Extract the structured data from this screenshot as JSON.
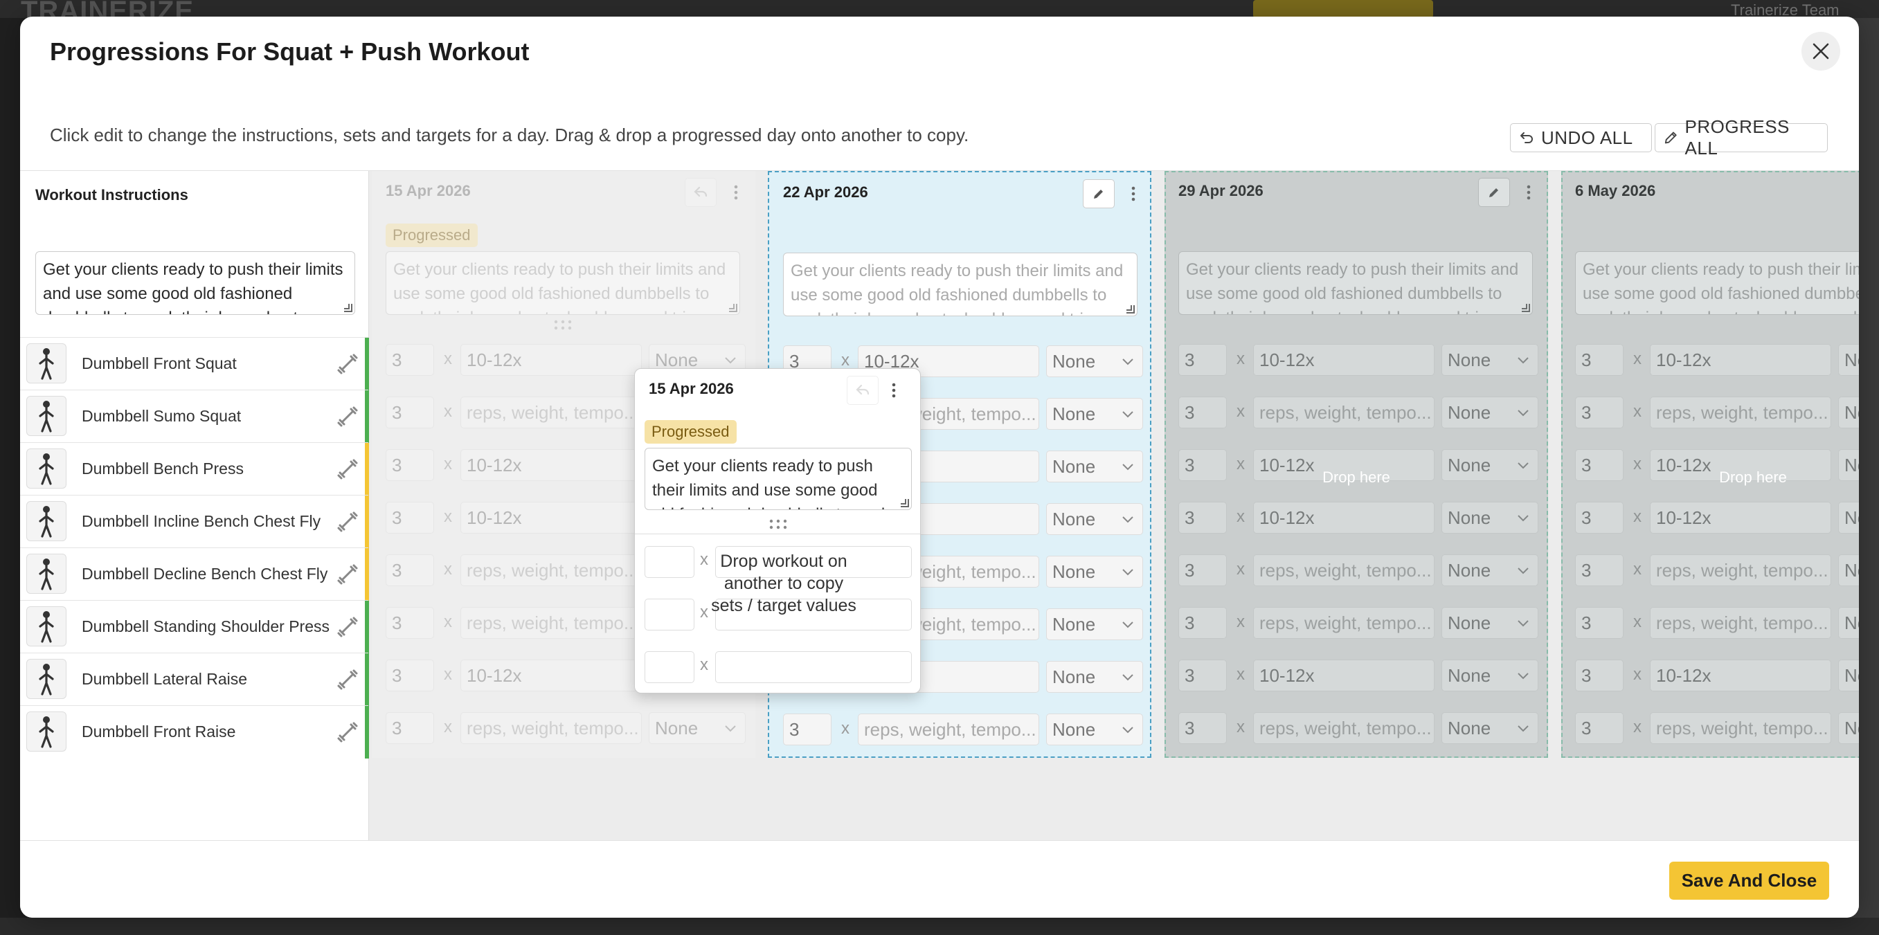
{
  "modal": {
    "title": "Progressions For Squat + Push Workout",
    "hint": "Click edit to change the instructions, sets and targets for a day. Drag & drop a progressed day onto another to copy.",
    "undo_all": "UNDO ALL",
    "progress_all": "PROGRESS ALL",
    "save_close": "Save And Close"
  },
  "left": {
    "label": "Workout Instructions",
    "instructions": "Get your clients ready to push their limits and use some good old fashioned dumbbells to work their legs, chest, shoulders, and triceps.",
    "exercises": [
      {
        "name": "Dumbbell Front Squat",
        "bar": "#4caf50"
      },
      {
        "name": "Dumbbell Sumo Squat",
        "bar": "#4caf50"
      },
      {
        "name": "Dumbbell Bench Press",
        "bar": "#f4c534"
      },
      {
        "name": "Dumbbell Incline Bench Chest Fly",
        "bar": "#f4c534"
      },
      {
        "name": "Dumbbell Decline Bench Chest Fly",
        "bar": "#f4c534"
      },
      {
        "name": "Dumbbell Standing Shoulder Press",
        "bar": "#4caf50"
      },
      {
        "name": "Dumbbell Lateral Raise",
        "bar": "#4caf50"
      },
      {
        "name": "Dumbbell Front Raise",
        "bar": "#4caf50"
      }
    ]
  },
  "columns": [
    {
      "date": "15 Apr 2026",
      "badge": "Progressed",
      "instructions": "Get your clients ready to push their limits and use some good old fashioned dumbbells to work their legs, chest, shoulders, and triceps."
    },
    {
      "date": "22 Apr 2026",
      "instructions": "Get your clients ready to push their limits and use some good old fashioned dumbbells to work their legs, chest, shoulders, and triceps."
    },
    {
      "date": "29 Apr 2026",
      "instructions": "Get your clients ready to push their limits and use some good old fashioned dumbbells to work their legs, chest, shoulders, and triceps.",
      "drop_label": "Drop here"
    },
    {
      "date": "6 May 2026",
      "instructions": "Get your clients ready to push their limits and use some good old fashioned dumbbells to work their legs, chest, shoulders, and triceps.",
      "drop_label": "Drop here"
    }
  ],
  "rows": [
    {
      "sets": "3",
      "target": "10-12x",
      "placeholder": false,
      "rest": "None"
    },
    {
      "sets": "3",
      "target": "reps, weight, tempo...",
      "placeholder": true,
      "rest": "None"
    },
    {
      "sets": "3",
      "target": "10-12x",
      "placeholder": false,
      "rest": "None"
    },
    {
      "sets": "3",
      "target": "10-12x",
      "placeholder": false,
      "rest": "None"
    },
    {
      "sets": "3",
      "target": "reps, weight, tempo...",
      "placeholder": true,
      "rest": "None"
    },
    {
      "sets": "3",
      "target": "reps, weight, tempo...",
      "placeholder": true,
      "rest": "None"
    },
    {
      "sets": "3",
      "target": "10-12x",
      "placeholder": false,
      "rest": "None"
    },
    {
      "sets": "3",
      "target": "reps, weight, tempo...",
      "placeholder": true,
      "rest": "None"
    }
  ],
  "dragged": {
    "date": "15 Apr 2026",
    "badge": "Progressed",
    "instructions": "Get your clients ready to push their limits and use some good old fashioned dumbbells to work their legs, chest, shoulders, and triceps.",
    "message": "Drop workout on another to copy sets / target values"
  },
  "colors": {
    "accent": "#f4c534",
    "highlight": "#dff1f8",
    "success": "#4caf50"
  },
  "background": {
    "logo": "TRAINERIZE",
    "user_name": "Trainerize Team"
  }
}
